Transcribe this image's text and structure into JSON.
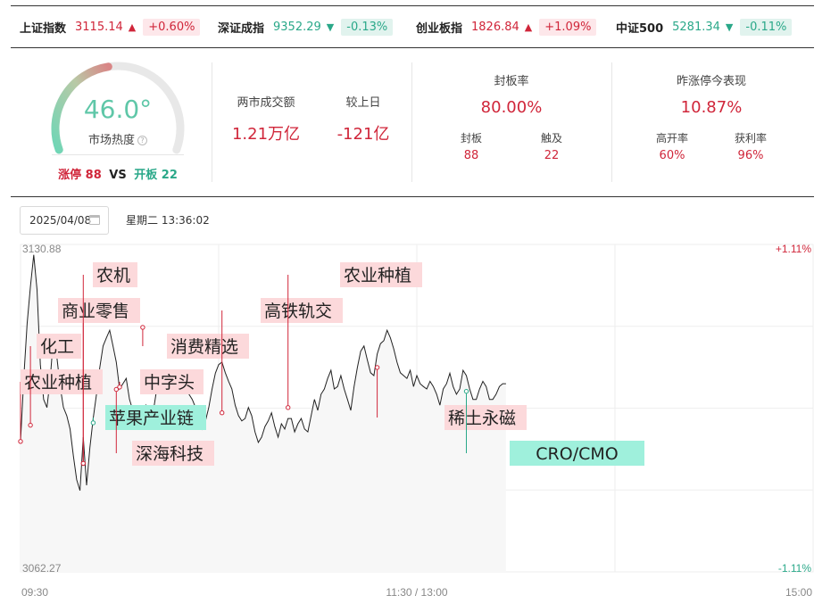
{
  "indices": [
    {
      "name": "上证指数",
      "price": "3115.14",
      "arrow": "▲",
      "change": "+0.60%",
      "dir": "up"
    },
    {
      "name": "深证成指",
      "price": "9352.29",
      "arrow": "▼",
      "change": "-0.13%",
      "dir": "dn"
    },
    {
      "name": "创业板指",
      "price": "1826.84",
      "arrow": "▲",
      "change": "+1.09%",
      "dir": "up"
    },
    {
      "name": "中证500",
      "price": "5281.34",
      "arrow": "▼",
      "change": "-0.11%",
      "dir": "dn"
    }
  ],
  "heat": {
    "value": "46.0°",
    "value_num": 46.0,
    "label": "市场热度",
    "help_icon": "question-icon",
    "limit_up_label": "涨停",
    "limit_up": "88",
    "vs": "VS",
    "opened_label": "开板",
    "opened": "22"
  },
  "turnover": {
    "label": "两市成交额",
    "value": "1.21万亿",
    "prev_label": "较上日",
    "prev_value": "-121亿"
  },
  "seal": {
    "label": "封板率",
    "value": "80.00%",
    "sealed_label": "封板",
    "sealed": "88",
    "touched_label": "触及",
    "touched": "22"
  },
  "yesterday": {
    "label": "昨涨停今表现",
    "value": "10.87%",
    "high_open_label": "高开率",
    "high_open": "60%",
    "profit_label": "获利率",
    "profit": "96%"
  },
  "date_picker": {
    "value": "2025/04/08",
    "icon": "calendar-icon"
  },
  "timestamp": "星期二 13:36:02",
  "colors": {
    "up": "#d0263a",
    "down": "#2aa889",
    "up_tag": "#fcd9db",
    "down_tag": "#9ff0dc",
    "gauge": "#5fc7a8"
  },
  "chart_data": {
    "type": "line",
    "y_max_label": "3130.88",
    "y_min_label": "3062.27",
    "pct_max_label": "+1.11%",
    "pct_min_label": "-1.11%",
    "ylim": [
      3062.27,
      3130.88
    ],
    "x_labels": [
      "09:30",
      "11:30 / 13:00",
      "15:00"
    ],
    "total_minutes": 240,
    "series": [
      {
        "values": [
          3089.6,
          3103.1,
          3114.3,
          3122.1,
          3128.7,
          3121.4,
          3105.7,
          3098.4,
          3096.7,
          3102.8,
          3111.8,
          3107.3,
          3101.1,
          3096.7,
          3095.0,
          3092.2,
          3086.6,
          3081.6,
          3079.3,
          3090.5,
          3080.4,
          3088.3,
          3094.4,
          3099.5,
          3105.1,
          3109.6,
          3111.3,
          3112.9,
          3109.6,
          3106.2,
          3100.6,
          3101.7,
          3102.8,
          3098.4,
          3096.1,
          3092.7,
          3094.4,
          3095.6,
          3097.2,
          3094.4,
          3095.0,
          3099.5,
          3101.1,
          3102.8,
          3103.4,
          3102.8,
          3103.9,
          3103.4,
          3102.2,
          3101.7,
          3100.6,
          3099.5,
          3098.4,
          3096.7,
          3094.4,
          3092.2,
          3093.9,
          3096.7,
          3100.6,
          3103.9,
          3105.7,
          3106.2,
          3104.0,
          3102.2,
          3100.6,
          3097.2,
          3095.0,
          3093.9,
          3094.4,
          3096.7,
          3095.0,
          3091.6,
          3089.4,
          3090.5,
          3092.7,
          3093.9,
          3095.6,
          3092.7,
          3090.5,
          3093.3,
          3092.2,
          3094.4,
          3094.4,
          3091.6,
          3093.3,
          3094.4,
          3092.2,
          3091.6,
          3095.0,
          3098.4,
          3096.1,
          3099.5,
          3100.6,
          3102.8,
          3104.5,
          3100.6,
          3101.1,
          3103.4,
          3100.6,
          3098.4,
          3096.1,
          3101.1,
          3105.1,
          3108.5,
          3109.6,
          3106.7,
          3104.0,
          3103.4,
          3107.9,
          3110.1,
          3110.7,
          3112.9,
          3111.3,
          3109.0,
          3106.2,
          3104.0,
          3103.4,
          3102.8,
          3104.5,
          3101.1,
          3103.4,
          3101.7,
          3101.1,
          3100.6,
          3102.2,
          3101.1,
          3099.5,
          3097.2,
          3100.6,
          3101.7,
          3103.9,
          3101.1,
          3099.5,
          3100.6,
          3104.5,
          3103.4,
          3100.6,
          3098.4,
          3098.4,
          3100.6,
          3102.2,
          3101.1,
          3098.4,
          3098.4,
          3099.5,
          3101.1,
          3101.7,
          3101.7
        ]
      }
    ],
    "annotations": [
      {
        "text": "农业种植",
        "minute": 0,
        "value": 3089.6,
        "dir": "up"
      },
      {
        "text": "化工",
        "minute": 3,
        "value": 3093.0,
        "dir": "up"
      },
      {
        "text": "商业零售",
        "minute": 19,
        "value": 3085.0,
        "dir": "up"
      },
      {
        "text": "农机",
        "minute": 19,
        "value": 3085.0,
        "dir": "up"
      },
      {
        "text": "苹果产业链",
        "minute": 22,
        "value": 3093.5,
        "dir": "down"
      },
      {
        "text": "深海科技",
        "minute": 29,
        "value": 3100.5,
        "dir": "up"
      },
      {
        "text": "中字头",
        "minute": 30,
        "value": 3101.0,
        "dir": "up"
      },
      {
        "text": "消费精选",
        "minute": 37,
        "value": 3113.5,
        "dir": "up"
      },
      {
        "text": "高铁轨交",
        "minute": 61,
        "value": 3095.6,
        "dir": "up"
      },
      {
        "text": "农业种植",
        "minute": 81,
        "value": 3096.7,
        "dir": "up"
      },
      {
        "text": "稀土永磁",
        "minute": 108,
        "value": 3105.1,
        "dir": "up"
      },
      {
        "text": "CRO/CMO",
        "minute": 135,
        "value": 3100.1,
        "dir": "down"
      }
    ]
  }
}
